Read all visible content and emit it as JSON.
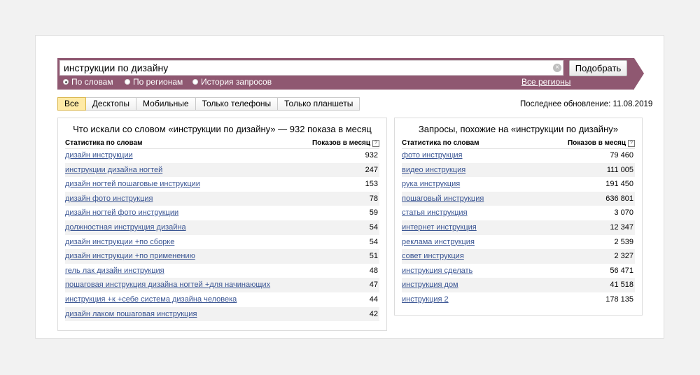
{
  "search": {
    "query": "инструкции по дизайну",
    "button_label": "Подобрать",
    "clear_glyph": "×",
    "modes": [
      "По словам",
      "По регионам",
      "История запросов"
    ],
    "selected_mode": "По словам",
    "regions_link": "Все регионы"
  },
  "tabs": [
    "Все",
    "Десктопы",
    "Мобильные",
    "Только телефоны",
    "Только планшеты"
  ],
  "active_tab": "Все",
  "last_update": "Последнее обновление: 11.08.2019",
  "left_panel": {
    "title": "Что искали со словом «инструкции по дизайну» — 932 показа в месяц",
    "col_words": "Статистика по словам",
    "col_shows": "Показов в месяц",
    "help_glyph": "?",
    "rows": [
      {
        "phrase": "дизайн инструкции",
        "count": "932"
      },
      {
        "phrase": "инструкции дизайна ногтей",
        "count": "247"
      },
      {
        "phrase": "дизайн ногтей пошаговые инструкции",
        "count": "153"
      },
      {
        "phrase": "дизайн фото инструкция",
        "count": "78"
      },
      {
        "phrase": "дизайн ногтей фото инструкции",
        "count": "59"
      },
      {
        "phrase": "должностная инструкция дизайна",
        "count": "54"
      },
      {
        "phrase": "дизайн инструкции +по сборке",
        "count": "54"
      },
      {
        "phrase": "дизайн инструкции +по применению",
        "count": "51"
      },
      {
        "phrase": "гель лак дизайн инструкция",
        "count": "48"
      },
      {
        "phrase": "пошаговая инструкция дизайна ногтей +для начинающих",
        "count": "47"
      },
      {
        "phrase": "инструкция +к +себе система дизайна человека",
        "count": "44"
      },
      {
        "phrase": "дизайн лаком пошаговая инструкция",
        "count": "42"
      }
    ]
  },
  "right_panel": {
    "title": "Запросы, похожие на «инструкции по дизайну»",
    "col_words": "Статистика по словам",
    "col_shows": "Показов в месяц",
    "help_glyph": "?",
    "rows": [
      {
        "phrase": "фото инструкция",
        "count": "79 460"
      },
      {
        "phrase": "видео инструкция",
        "count": "111 005"
      },
      {
        "phrase": "рука инструкция",
        "count": "191 450"
      },
      {
        "phrase": "пошаговый инструкция",
        "count": "636 801"
      },
      {
        "phrase": "статья инструкция",
        "count": "3 070"
      },
      {
        "phrase": "интернет инструкция",
        "count": "12 347"
      },
      {
        "phrase": "реклама инструкция",
        "count": "2 539"
      },
      {
        "phrase": "совет инструкция",
        "count": "2 327"
      },
      {
        "phrase": "инструкция сделать",
        "count": "56 471"
      },
      {
        "phrase": "инструкция дом",
        "count": "41 518"
      },
      {
        "phrase": "инструкция 2",
        "count": "178 135"
      }
    ]
  },
  "colors": {
    "brand": "#8f5871",
    "link": "#3a5593",
    "active_tab": "#ffeaa6"
  }
}
